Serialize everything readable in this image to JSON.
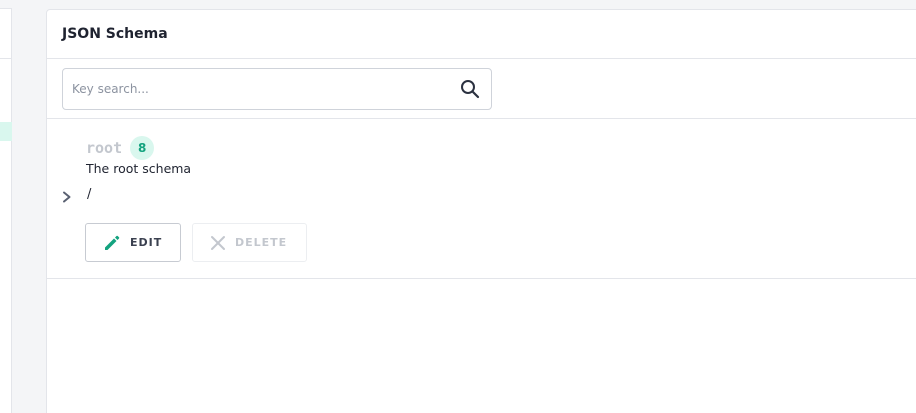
{
  "panel": {
    "title": "JSON Schema"
  },
  "search": {
    "placeholder": "Key search...",
    "value": "",
    "icon": "search-icon"
  },
  "node": {
    "key": "root",
    "count": "8",
    "description": "The root schema",
    "path": "/",
    "expand_icon": "chevron-right-icon"
  },
  "actions": {
    "edit_label": "EDIT",
    "edit_icon": "pencil-icon",
    "delete_label": "DELETE",
    "delete_icon": "close-icon"
  },
  "colors": {
    "accent": "#14a37f",
    "badge_bg": "#d9f7ee",
    "border": "#e3e5ea",
    "text": "#1f2330",
    "muted": "#c3c7ce"
  }
}
